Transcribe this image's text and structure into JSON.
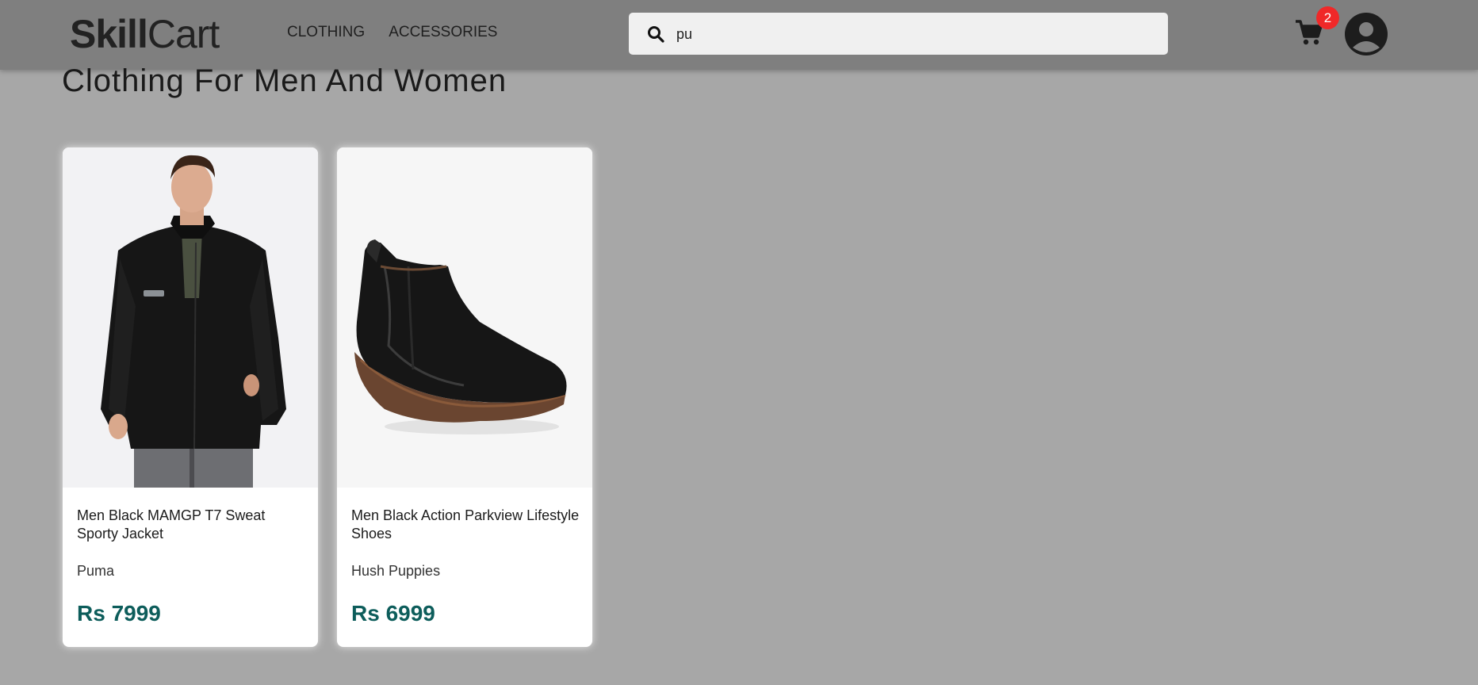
{
  "header": {
    "logo_bold": "Skill",
    "logo_light": "Cart",
    "nav": [
      "CLOTHING",
      "ACCESSORIES"
    ],
    "search_value": "pu",
    "cart_count": "2"
  },
  "main": {
    "title": "Clothing For Men And Women",
    "products": [
      {
        "name": "Men Black MAMGP T7 Sweat Sporty Jacket",
        "brand": "Puma",
        "price": "Rs 7999"
      },
      {
        "name": "Men Black Action Parkview Lifestyle Shoes",
        "brand": "Hush Puppies",
        "price": "Rs 6999"
      }
    ]
  }
}
